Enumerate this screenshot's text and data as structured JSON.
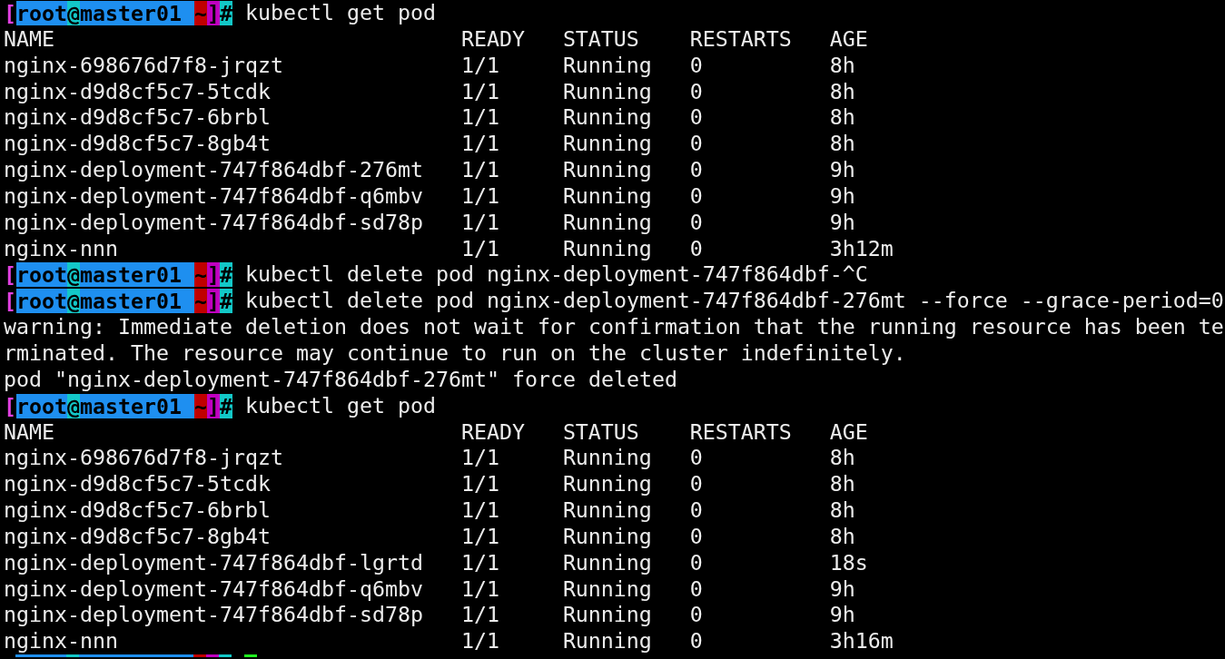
{
  "terminal": {
    "lines": [
      {
        "kind": "prompt",
        "open": "[",
        "user": "root",
        "at": "@",
        "host": "master01",
        "dir": "~",
        "close": "]",
        "sign": "#",
        "command": "kubectl get pod"
      },
      {
        "kind": "header",
        "cells": [
          "NAME",
          "READY",
          "STATUS",
          "RESTARTS",
          "AGE"
        ]
      },
      {
        "kind": "row",
        "cells": [
          "nginx-698676d7f8-jrqzt",
          "1/1",
          "Running",
          "0",
          "8h"
        ]
      },
      {
        "kind": "row",
        "cells": [
          "nginx-d9d8cf5c7-5tcdk",
          "1/1",
          "Running",
          "0",
          "8h"
        ]
      },
      {
        "kind": "row",
        "cells": [
          "nginx-d9d8cf5c7-6brbl",
          "1/1",
          "Running",
          "0",
          "8h"
        ]
      },
      {
        "kind": "row",
        "cells": [
          "nginx-d9d8cf5c7-8gb4t",
          "1/1",
          "Running",
          "0",
          "8h"
        ]
      },
      {
        "kind": "row",
        "cells": [
          "nginx-deployment-747f864dbf-276mt",
          "1/1",
          "Running",
          "0",
          "9h"
        ]
      },
      {
        "kind": "row",
        "cells": [
          "nginx-deployment-747f864dbf-q6mbv",
          "1/1",
          "Running",
          "0",
          "9h"
        ]
      },
      {
        "kind": "row",
        "cells": [
          "nginx-deployment-747f864dbf-sd78p",
          "1/1",
          "Running",
          "0",
          "9h"
        ]
      },
      {
        "kind": "row",
        "cells": [
          "nginx-nnn",
          "1/1",
          "Running",
          "0",
          "3h12m"
        ]
      },
      {
        "kind": "prompt",
        "open": "[",
        "user": "root",
        "at": "@",
        "host": "master01",
        "dir": "~",
        "close": "]",
        "sign": "#",
        "command": "kubectl delete pod nginx-deployment-747f864dbf-^C"
      },
      {
        "kind": "prompt",
        "open": "[",
        "user": "root",
        "at": "@",
        "host": "master01",
        "dir": "~",
        "close": "]",
        "sign": "#",
        "command": "kubectl delete pod nginx-deployment-747f864dbf-276mt --force --grace-period=0"
      },
      {
        "kind": "text",
        "text": "warning: Immediate deletion does not wait for confirmation that the running resource has been te"
      },
      {
        "kind": "text",
        "text": "rminated. The resource may continue to run on the cluster indefinitely."
      },
      {
        "kind": "text",
        "text": "pod \"nginx-deployment-747f864dbf-276mt\" force deleted"
      },
      {
        "kind": "prompt",
        "open": "[",
        "user": "root",
        "at": "@",
        "host": "master01",
        "dir": "~",
        "close": "]",
        "sign": "#",
        "command": "kubectl get pod"
      },
      {
        "kind": "header",
        "cells": [
          "NAME",
          "READY",
          "STATUS",
          "RESTARTS",
          "AGE"
        ]
      },
      {
        "kind": "row",
        "cells": [
          "nginx-698676d7f8-jrqzt",
          "1/1",
          "Running",
          "0",
          "8h"
        ]
      },
      {
        "kind": "row",
        "cells": [
          "nginx-d9d8cf5c7-5tcdk",
          "1/1",
          "Running",
          "0",
          "8h"
        ]
      },
      {
        "kind": "row",
        "cells": [
          "nginx-d9d8cf5c7-6brbl",
          "1/1",
          "Running",
          "0",
          "8h"
        ]
      },
      {
        "kind": "row",
        "cells": [
          "nginx-d9d8cf5c7-8gb4t",
          "1/1",
          "Running",
          "0",
          "8h"
        ]
      },
      {
        "kind": "row",
        "cells": [
          "nginx-deployment-747f864dbf-lgrtd",
          "1/1",
          "Running",
          "0",
          "18s"
        ]
      },
      {
        "kind": "row",
        "cells": [
          "nginx-deployment-747f864dbf-q6mbv",
          "1/1",
          "Running",
          "0",
          "9h"
        ]
      },
      {
        "kind": "row",
        "cells": [
          "nginx-deployment-747f864dbf-sd78p",
          "1/1",
          "Running",
          "0",
          "9h"
        ]
      },
      {
        "kind": "row",
        "cells": [
          "nginx-nnn",
          "1/1",
          "Running",
          "0",
          "3h16m"
        ]
      }
    ]
  }
}
